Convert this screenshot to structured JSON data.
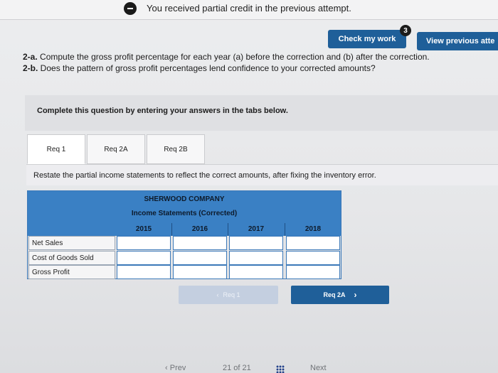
{
  "banner": {
    "text": "You received partial credit in the previous attempt."
  },
  "toolbar": {
    "check_label": "Check my work",
    "check_badge": "3",
    "view_previous_label": "View previous atte"
  },
  "question": {
    "line_2a_prefix": "2-a.",
    "line_2a_text": " Compute the gross profit percentage for each year (a) before the correction and (b) after the correction.",
    "line_2b_prefix": "2-b.",
    "line_2b_text": " Does the pattern of gross profit percentages lend confidence to your corrected amounts?"
  },
  "instruction": "Complete this question by entering your answers in the tabs below.",
  "tabs": [
    {
      "label": "Req 1",
      "active": true
    },
    {
      "label": "Req 2A",
      "active": false
    },
    {
      "label": "Req 2B",
      "active": false
    }
  ],
  "content": {
    "text": "Restate the partial income statements to reflect the correct amounts, after fixing the inventory error."
  },
  "statement": {
    "company": "SHERWOOD COMPANY",
    "subtitle": "Income Statements (Corrected)",
    "years": [
      "2015",
      "2016",
      "2017",
      "2018"
    ],
    "rows": [
      {
        "label": "Net Sales",
        "values": [
          "",
          "",
          "",
          ""
        ]
      },
      {
        "label": "Cost of Goods Sold",
        "values": [
          "",
          "",
          "",
          ""
        ]
      },
      {
        "label": "Gross Profit",
        "values": [
          "",
          "",
          "",
          ""
        ]
      }
    ]
  },
  "nav": {
    "prev_label": "Req 1",
    "next_label": "Req 2A"
  },
  "footer": {
    "prev_fragment": "Prev",
    "page_fragment": "21 of 21",
    "next_fragment": "Next"
  },
  "colors": {
    "primary": "#1f5f99",
    "table_header": "#3a80c4"
  }
}
